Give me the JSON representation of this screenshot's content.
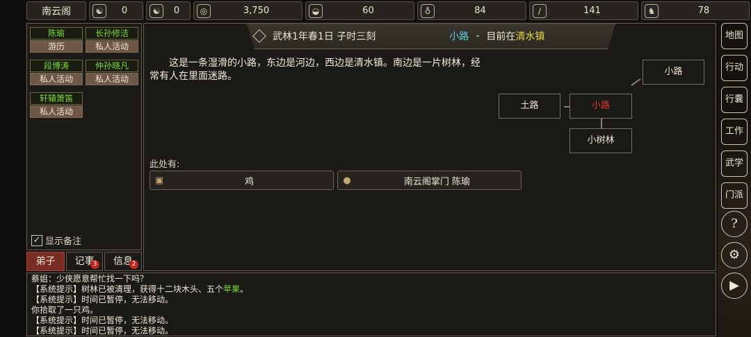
{
  "topbar": {
    "sect_name": "南云阁",
    "resources": [
      {
        "icon": "scroll-emblem-icon",
        "glyph": "☯",
        "value": "0"
      },
      {
        "icon": "yin-yang-icon",
        "glyph": "☯",
        "value": "0"
      },
      {
        "icon": "coin-icon",
        "glyph": "◎",
        "value": "3,750"
      },
      {
        "icon": "food-bowl-icon",
        "glyph": "◒",
        "value": "60"
      },
      {
        "icon": "gourd-icon",
        "glyph": "♁",
        "value": "84"
      },
      {
        "icon": "wood-log-icon",
        "glyph": "∕",
        "value": "141"
      },
      {
        "icon": "beast-icon",
        "glyph": "♞",
        "value": "78"
      }
    ]
  },
  "disciples": [
    {
      "name": "陈瑜",
      "status": "游历"
    },
    {
      "name": "长孙修洁",
      "status": "私人活动"
    },
    {
      "name": "段博涛",
      "status": "私人活动"
    },
    {
      "name": "仲孙晓凡",
      "status": "私人活动"
    },
    {
      "name": "轩辕箫笛",
      "status": "私人活动"
    }
  ],
  "show_notes_label": "显示备注",
  "tabs": [
    {
      "label": "弟子",
      "badge": ""
    },
    {
      "label": "记事",
      "badge": "3"
    },
    {
      "label": "信息",
      "badge": "2"
    }
  ],
  "header": {
    "date": "武林1年春1日 子时三刻",
    "location": "小路",
    "dash": "-",
    "current_prefix": "目前在",
    "town": "清水镇"
  },
  "description": "这是一条湿滑的小路，东边是河边，西边是清水镇。南边是一片树林，经常有人在里面迷路。",
  "map": {
    "north_east": "小路",
    "west": "土路",
    "current": "小路",
    "south": "小树林"
  },
  "here_label": "此处有:",
  "entities": [
    {
      "icon": "item-box-icon",
      "glyph": "▣",
      "label": "鸡"
    },
    {
      "icon": "person-icon",
      "glyph": "●",
      "label": "南云阁掌门 陈瑜"
    }
  ],
  "log": {
    "quest": "蔡姐：少侠愿意帮忙找一下吗？",
    "line1_prefix": "【系统提示】树林已被清理，获得十二块木头、五个",
    "line1_hl": "苹果",
    "line1_suffix": "。",
    "line2": "【系统提示】时间已暂停，无法移动。",
    "line3": "你拾取了一只鸡。",
    "line4": "【系统提示】时间已暂停，无法移动。",
    "line5": "【系统提示】时间已暂停，无法移动。"
  },
  "right_menu": [
    {
      "label": "地图",
      "icon": "map-icon"
    },
    {
      "label": "行动",
      "icon": "action-icon"
    },
    {
      "label": "行囊",
      "icon": "bag-icon"
    },
    {
      "label": "工作",
      "icon": "work-icon"
    },
    {
      "label": "武学",
      "icon": "martial-icon"
    },
    {
      "label": "门派",
      "icon": "sect-icon"
    },
    {
      "label": "?",
      "icon": "help-icon"
    },
    {
      "label": "⚙",
      "icon": "settings-gear-icon"
    },
    {
      "label": "▶",
      "icon": "play-icon"
    }
  ]
}
